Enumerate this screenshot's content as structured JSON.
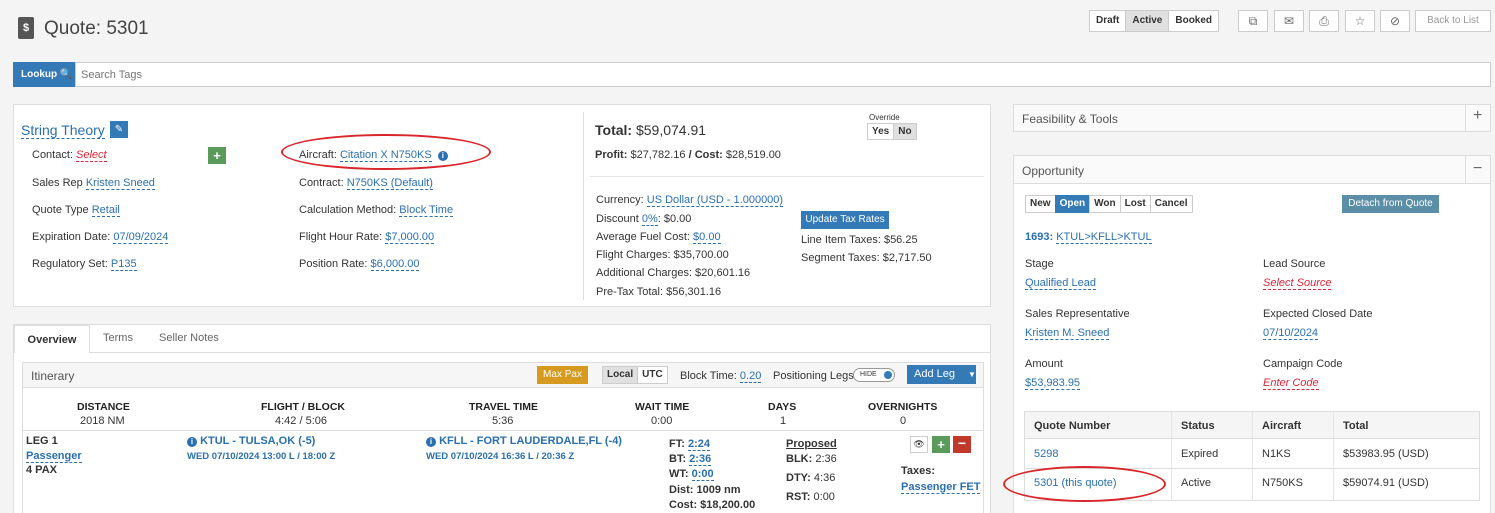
{
  "header": {
    "title": "Quote: 5301",
    "status_buttons": [
      "Draft",
      "Active",
      "Booked"
    ],
    "back_label": "Back to List"
  },
  "lookup": {
    "label": "Lookup",
    "placeholder": "Search Tags"
  },
  "quote": {
    "client": "String Theory",
    "contact_label": "Contact:",
    "contact_value": "Select",
    "sales_rep_label": "Sales Rep",
    "sales_rep_value": "Kristen Sneed",
    "quote_type_label": "Quote Type",
    "quote_type_value": "Retail",
    "expiration_label": "Expiration Date:",
    "expiration_value": "07/09/2024",
    "regulatory_label": "Regulatory Set:",
    "regulatory_value": "P135",
    "aircraft_label": "Aircraft:",
    "aircraft_value": "Citation X N750KS",
    "contract_label": "Contract:",
    "contract_value": "N750KS (Default)",
    "calc_label": "Calculation Method:",
    "calc_value": "Block Time",
    "fhr_label": "Flight Hour Rate:",
    "fhr_value": "$7,000.00",
    "pos_label": "Position Rate:",
    "pos_value": "$6,000.00"
  },
  "totals": {
    "total_label": "Total:",
    "total_value": "$59,074.91",
    "profit_label": "Profit:",
    "profit_value": "$27,782.16",
    "cost_label": "/ Cost:",
    "cost_value": "$28,519.00",
    "override_label": "Override",
    "yes": "Yes",
    "no": "No",
    "currency_label": "Currency:",
    "currency_value": "US Dollar (USD - 1.000000)",
    "discount_label": "Discount",
    "discount_pct": "0%",
    "discount_value": ": $0.00",
    "fuel_label": "Average Fuel Cost:",
    "fuel_value": "$0.00",
    "flight_charges": "Flight Charges: $35,700.00",
    "additional_charges": "Additional Charges: $20,601.16",
    "pretax": "Pre-Tax Total: $56,301.16",
    "update_tax": "Update Tax Rates",
    "line_item_taxes": "Line Item Taxes: $56.25",
    "segment_taxes": "Segment Taxes: $2,717.50"
  },
  "tabs": [
    "Overview",
    "Terms",
    "Seller Notes"
  ],
  "itinerary": {
    "title": "Itinerary",
    "max_pax": "Max Pax",
    "local": "Local",
    "utc": "UTC",
    "block_time_label": "Block Time:",
    "block_time_value": "0.20",
    "positioning_label": "Positioning Legs",
    "hide": "HIDE",
    "add_leg": "Add Leg",
    "summary": {
      "distance_h": "DISTANCE",
      "distance_v": "2018 NM",
      "flight_h": "FLIGHT / BLOCK",
      "flight_v": "4:42 / 5:06",
      "travel_h": "TRAVEL TIME",
      "travel_v": "5:36",
      "wait_h": "WAIT TIME",
      "wait_v": "0:00",
      "days_h": "DAYS",
      "days_v": "1",
      "overnights_h": "OVERNIGHTS",
      "overnights_v": "0"
    },
    "leg": {
      "name": "LEG 1",
      "type": "Passenger",
      "pax": "4 PAX",
      "from": "KTUL - TULSA,OK (-5)",
      "from_time": "WED 07/10/2024 13:00 L / 18:00 Z",
      "to": "KFLL - FORT LAUDERDALE,FL (-4)",
      "to_time": "WED 07/10/2024 16:36 L / 20:36 Z",
      "ft_label": "FT:",
      "ft": "2:24",
      "bt_label": "BT:",
      "bt": "2:36",
      "wt_label": "WT:",
      "wt": "0:00",
      "dist": "Dist: 1009 nm",
      "cost": "Cost: $18,200.00",
      "proposed": "Proposed",
      "blk_label": "BLK:",
      "blk": "2:36",
      "dty_label": "DTY:",
      "dty": "4:36",
      "rst_label": "RST:",
      "rst": "0:00",
      "taxes_label": "Taxes:",
      "taxes_value": "Passenger FET"
    }
  },
  "feasibility": {
    "title": "Feasibility & Tools"
  },
  "opportunity": {
    "title": "Opportunity",
    "stages": [
      "New",
      "Open",
      "Won",
      "Lost",
      "Cancel"
    ],
    "detach": "Detach from Quote",
    "trip_id": "1693:",
    "trip_route": "KTUL>KFLL>KTUL",
    "stage_label": "Stage",
    "stage_value": "Qualified Lead",
    "lead_label": "Lead Source",
    "lead_value": "Select Source",
    "rep_label": "Sales Representative",
    "rep_value": "Kristen M. Sneed",
    "close_label": "Expected Closed Date",
    "close_value": "07/10/2024",
    "amount_label": "Amount",
    "amount_value": "$53,983.95",
    "campaign_label": "Campaign Code",
    "campaign_value": "Enter Code",
    "table": {
      "headers": [
        "Quote Number",
        "Status",
        "Aircraft",
        "Total"
      ],
      "rows": [
        [
          "5298",
          "Expired",
          "N1KS",
          "$53983.95 (USD)"
        ],
        [
          "5301 (this quote)",
          "Active",
          "N750KS",
          "$59074.91 (USD)"
        ]
      ]
    }
  },
  "colors": {
    "link": "#2a6fb0",
    "accent": "#337ab7",
    "highlight": "#d9262b",
    "max_pax": "#d69a1e",
    "plus_green": "#5a9a5a",
    "minus_red": "#c0392b"
  }
}
